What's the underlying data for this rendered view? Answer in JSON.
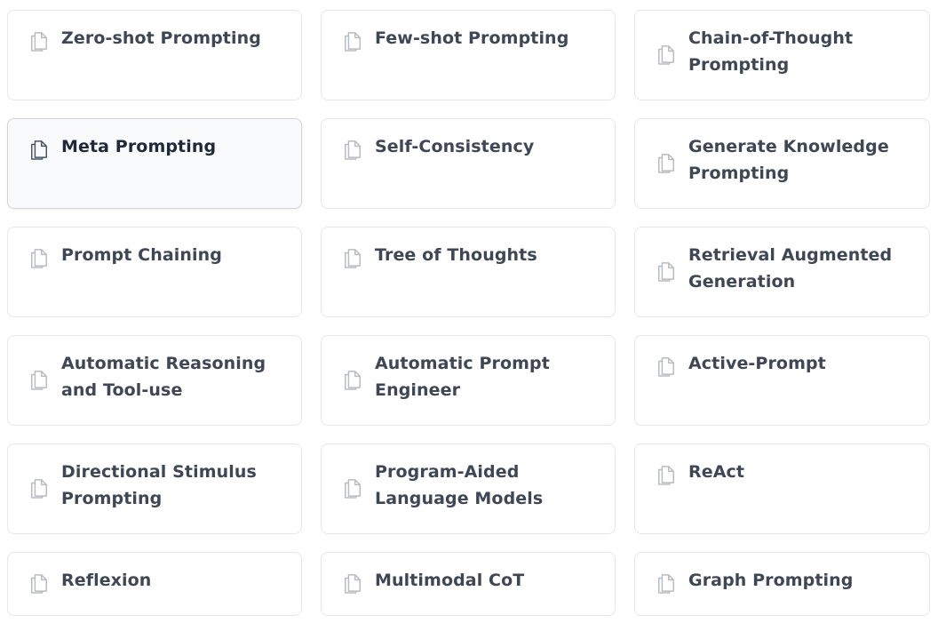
{
  "cards": [
    {
      "title": "Zero-shot Prompting",
      "icon": "document-copy-icon"
    },
    {
      "title": "Few-shot Prompting",
      "icon": "document-copy-icon"
    },
    {
      "title": "Chain-of-Thought Prompting",
      "icon": "document-copy-icon"
    },
    {
      "title": "Meta Prompting",
      "icon": "document-copy-icon"
    },
    {
      "title": "Self-Consistency",
      "icon": "document-copy-icon"
    },
    {
      "title": "Generate Knowledge Prompting",
      "icon": "document-copy-icon"
    },
    {
      "title": "Prompt Chaining",
      "icon": "document-copy-icon"
    },
    {
      "title": "Tree of Thoughts",
      "icon": "document-copy-icon"
    },
    {
      "title": "Retrieval Augmented Generation",
      "icon": "document-copy-icon"
    },
    {
      "title": "Automatic Reasoning and Tool-use",
      "icon": "document-copy-icon"
    },
    {
      "title": "Automatic Prompt Engineer",
      "icon": "document-copy-icon"
    },
    {
      "title": "Active-Prompt",
      "icon": "document-copy-icon"
    },
    {
      "title": "Directional Stimulus Prompting",
      "icon": "document-copy-icon"
    },
    {
      "title": "Program-Aided Language Models",
      "icon": "document-copy-icon"
    },
    {
      "title": "ReAct",
      "icon": "document-copy-icon"
    },
    {
      "title": "Reflexion",
      "icon": "document-copy-icon"
    },
    {
      "title": "Multimodal CoT",
      "icon": "document-copy-icon"
    },
    {
      "title": "Graph Prompting",
      "icon": "document-copy-icon"
    }
  ],
  "colors": {
    "border": "#e5e7eb",
    "hover_background": "#f8fafc",
    "text": "#3f4654",
    "icon": "#b8bcc2"
  }
}
